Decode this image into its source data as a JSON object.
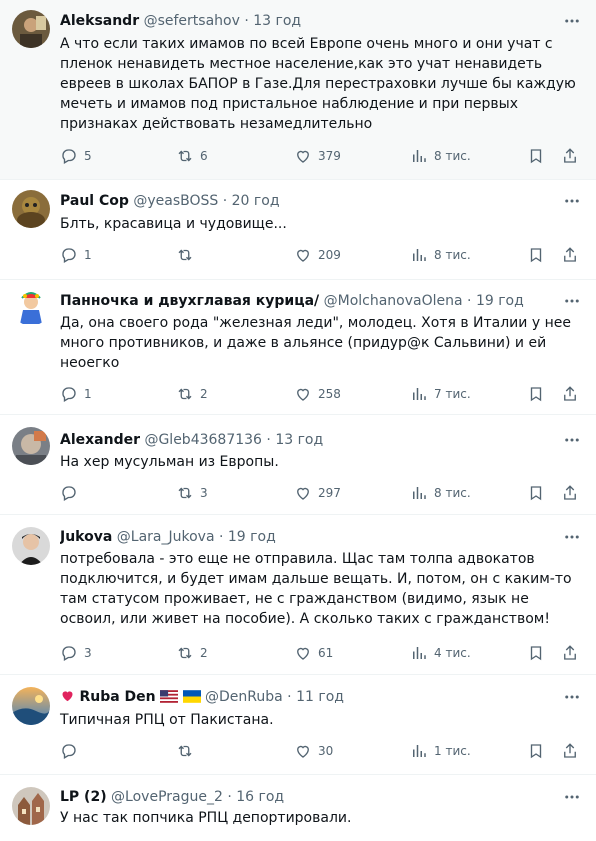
{
  "replies": [
    {
      "name": "Aleksandr",
      "handle": "@sefertsahov",
      "separator": "·",
      "time": "13 год",
      "text": "А что если таких имамов по всей Европе очень много и они учат с пленок ненавидеть местное население,как это учат ненавидеть евреев в школах БАПОР в Газе.Для перестраховки лучше бы каждую мечеть и имамов под пристальное наблюдение и при первых признаках действовать незамедлительно",
      "replies_count": "5",
      "reposts_count": "6",
      "likes_count": "379",
      "views_count": "8 тис."
    },
    {
      "name": "Paul Cop",
      "handle": "@yeasBOSS",
      "separator": "·",
      "time": "20 год",
      "text": "Блть, красавица и чудовище...",
      "replies_count": "1",
      "reposts_count": "",
      "likes_count": "209",
      "views_count": "8 тис."
    },
    {
      "name": "Панночка и двухглавая курица/",
      "handle": "@MolchanovaOlena",
      "separator": "·",
      "time": "19 год",
      "text": "Да, она своего рода \"железная леди\", молодец. Хотя в Италии у нее много противников, и даже в альянсе (придур@к Сальвини) и ей неоегко",
      "replies_count": "1",
      "reposts_count": "2",
      "likes_count": "258",
      "views_count": "7 тис."
    },
    {
      "name": "Alexander",
      "handle": "@Gleb43687136",
      "separator": "·",
      "time": "13 год",
      "text": "На хер мусульман из Европы.",
      "replies_count": "",
      "reposts_count": "3",
      "likes_count": "297",
      "views_count": "8 тис."
    },
    {
      "name": "Jukova",
      "handle": "@Lara_Jukova",
      "separator": "·",
      "time": "19 год",
      "text": "потребовала - это еще не отправила. Щас там толпа адвокатов подключится, и будет имам дальше вещать. И, потом, он с каким-то там статусом проживает, не с гражданством (видимо, язык не освоил, или живет на пособие). А сколько таких с гражданством!",
      "replies_count": "3",
      "reposts_count": "2",
      "likes_count": "61",
      "views_count": "4 тис."
    },
    {
      "name": "Ruba Den",
      "handle": "@DenRuba",
      "separator": "·",
      "time": "11 год",
      "text": "Типичная РПЦ от Пакистана.",
      "replies_count": "",
      "reposts_count": "",
      "likes_count": "30",
      "views_count": "1 тис."
    },
    {
      "name": "LP (2)",
      "handle": "@LovePrague_2",
      "separator": "·",
      "time": "16 год",
      "text": "У нас так попчика РПЦ депортировали."
    }
  ],
  "icons": {
    "more": "more-dots-icon",
    "reply": "reply-icon",
    "repost": "repost-icon",
    "like": "like-icon",
    "views": "views-icon",
    "bookmark": "bookmark-icon",
    "share": "share-icon",
    "heart_badge": "red-heart-icon",
    "flag_us": "us-flag-icon",
    "flag_ua": "ua-flag-icon"
  },
  "colors": {
    "text": "#0f1419",
    "secondary": "#536471",
    "divider": "#eff3f4",
    "highlight_bg": "#f7f9f9",
    "heart": "#e0245e"
  }
}
